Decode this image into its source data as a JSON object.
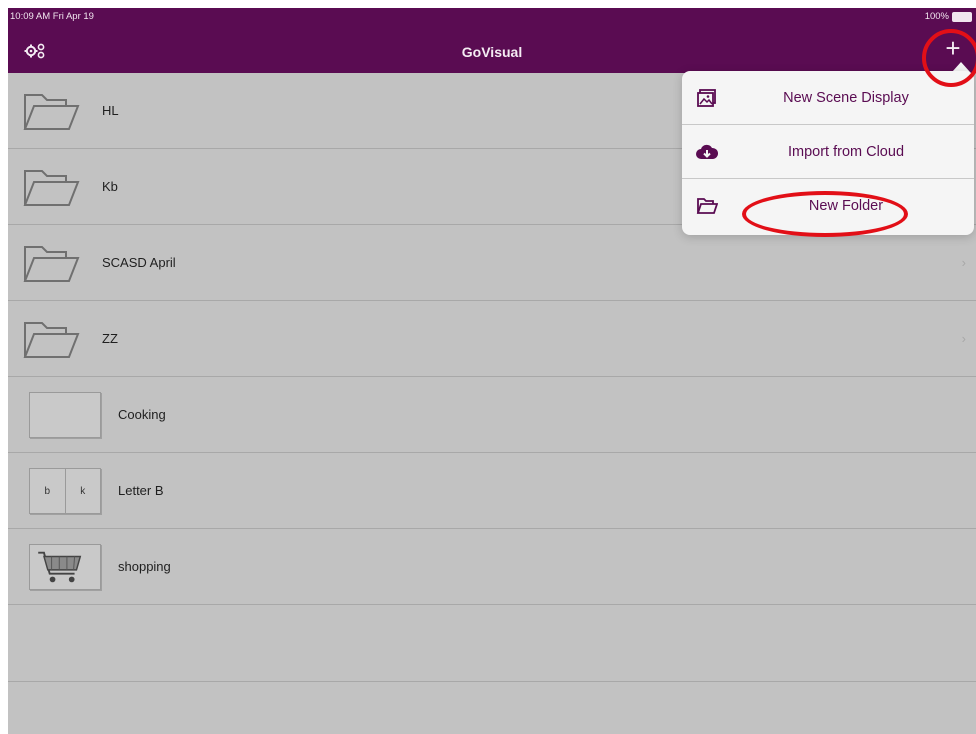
{
  "status": {
    "time": "10:09 AM  Fri Apr 19",
    "battery": "100%"
  },
  "header": {
    "title": "GoVisual",
    "add_label": "+"
  },
  "rows": [
    {
      "label": "HL",
      "kind": "folder"
    },
    {
      "label": "Kb",
      "kind": "folder"
    },
    {
      "label": "SCASD April",
      "kind": "folder"
    },
    {
      "label": "ZZ",
      "kind": "folder"
    },
    {
      "label": "Cooking",
      "kind": "board"
    },
    {
      "label": "Letter B",
      "kind": "board",
      "cells": [
        "b",
        "k"
      ]
    },
    {
      "label": "shopping",
      "kind": "board",
      "icon": "shopping-cart-icon"
    }
  ],
  "menu": {
    "items": [
      {
        "label": "New Scene Display",
        "icon": "scene-display-icon"
      },
      {
        "label": "Import from Cloud",
        "icon": "cloud-download-icon"
      },
      {
        "label": "New Folder",
        "icon": "folder-icon"
      }
    ]
  },
  "colors": {
    "header": "#5a0c52",
    "background": "#c2c2c2",
    "menu_text": "#5a0c52",
    "highlight": "#e20f17"
  }
}
